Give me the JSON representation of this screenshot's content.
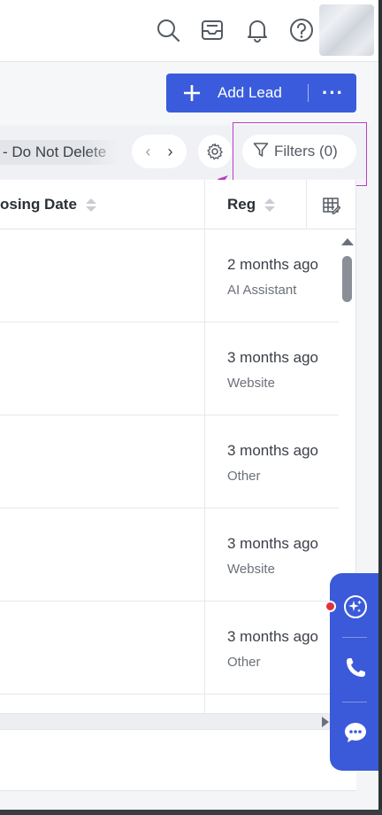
{
  "topbar": {
    "icons": [
      "search-icon",
      "inbox-icon",
      "bell-icon",
      "help-icon"
    ],
    "avatar": "avatar"
  },
  "actions": {
    "add_lead_label": "Add Lead",
    "more_label": "···"
  },
  "viewbar": {
    "view_name": "- Do Not Delete",
    "prev_label": "‹",
    "next_label": "›",
    "filters_label": "Filters (0)"
  },
  "table": {
    "columns": [
      {
        "label": "osing Date"
      },
      {
        "label": "Reg"
      }
    ],
    "rows": [
      {
        "when": "2 months ago",
        "source": "AI Assistant"
      },
      {
        "when": "3 months ago",
        "source": "Website"
      },
      {
        "when": "3 months ago",
        "source": "Other"
      },
      {
        "when": "3 months ago",
        "source": "Website"
      },
      {
        "when": "3 months ago",
        "source": "Other"
      }
    ]
  },
  "floating_panel": {
    "items": [
      "ai-assistant-icon",
      "phone-icon",
      "chat-icon"
    ],
    "notification": true
  },
  "colors": {
    "primary": "#3a5cdc",
    "highlight": "#b73ec3",
    "notification": "#e0323c"
  }
}
